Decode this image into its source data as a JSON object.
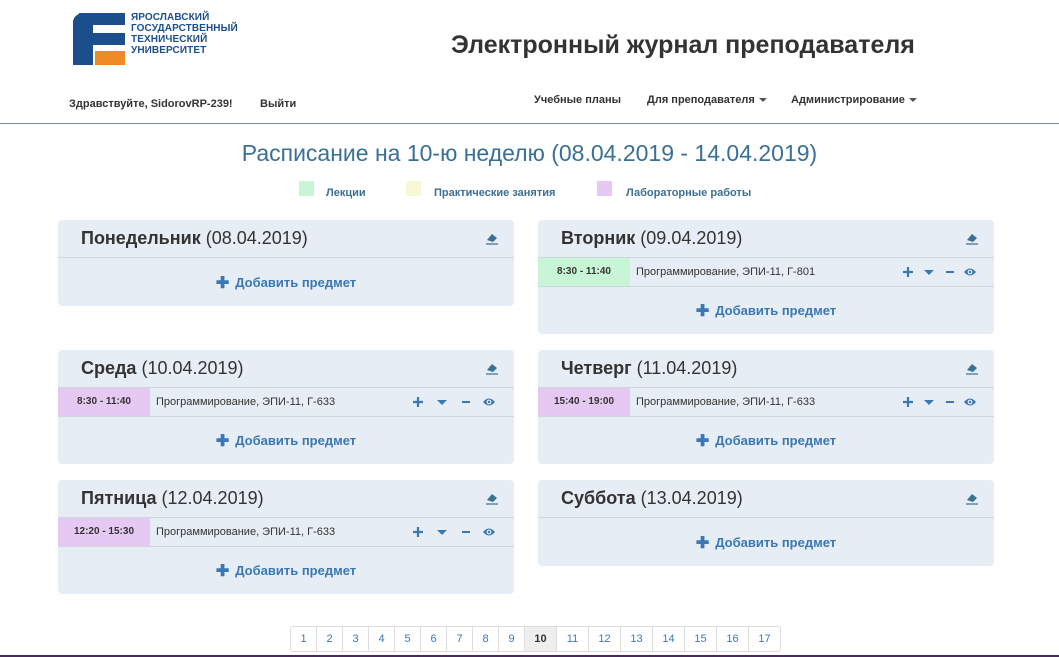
{
  "colors": {
    "lecture": "#c8f5d6",
    "practice": "#f7f9d6",
    "lab": "#e6c9f2",
    "accent": "#3a78b5",
    "title": "#3a6f96"
  },
  "logo": {
    "lines": [
      "ЯРОСЛАВСКИЙ",
      "ГОСУДАРСТВЕННЫЙ",
      "ТЕХНИЧЕСКИЙ",
      "УНИВЕРСИТЕТ"
    ]
  },
  "app_title": "Электронный журнал преподавателя",
  "user": {
    "greeting": "Здравствуйте, SidorovRP-239!",
    "logout": "Выйти"
  },
  "nav": {
    "plans": "Учебные планы",
    "teacher": "Для преподавателя",
    "admin": "Администрирование"
  },
  "week_title": "Расписание на 10-ю неделю (08.04.2019 - 14.04.2019)",
  "legend": {
    "lecture": "Лекции",
    "practice": "Практические занятия",
    "lab": "Лабораторные работы"
  },
  "add_label": "Добавить предмет",
  "days": [
    {
      "name": "Понедельник",
      "date": "(08.04.2019)",
      "lessons": []
    },
    {
      "name": "Вторник",
      "date": "(09.04.2019)",
      "lessons": [
        {
          "time": "8:30 - 11:40",
          "desc": "Программирование, ЭПИ-11, Г-801",
          "kind": "lecture"
        }
      ]
    },
    {
      "name": "Среда",
      "date": "(10.04.2019)",
      "lessons": [
        {
          "time": "8:30 - 11:40",
          "desc": "Программирование, ЭПИ-11, Г-633",
          "kind": "lab"
        }
      ]
    },
    {
      "name": "Четверг",
      "date": "(11.04.2019)",
      "lessons": [
        {
          "time": "15:40 - 19:00",
          "desc": "Программирование, ЭПИ-11, Г-633",
          "kind": "lab"
        }
      ]
    },
    {
      "name": "Пятница",
      "date": "(12.04.2019)",
      "lessons": [
        {
          "time": "12:20 - 15:30",
          "desc": "Программирование, ЭПИ-11, Г-633",
          "kind": "lab"
        }
      ]
    },
    {
      "name": "Суббота",
      "date": "(13.04.2019)",
      "lessons": []
    }
  ],
  "pages": [
    "1",
    "2",
    "3",
    "4",
    "5",
    "6",
    "7",
    "8",
    "9",
    "10",
    "11",
    "12",
    "13",
    "14",
    "15",
    "16",
    "17"
  ],
  "current_page": "10"
}
